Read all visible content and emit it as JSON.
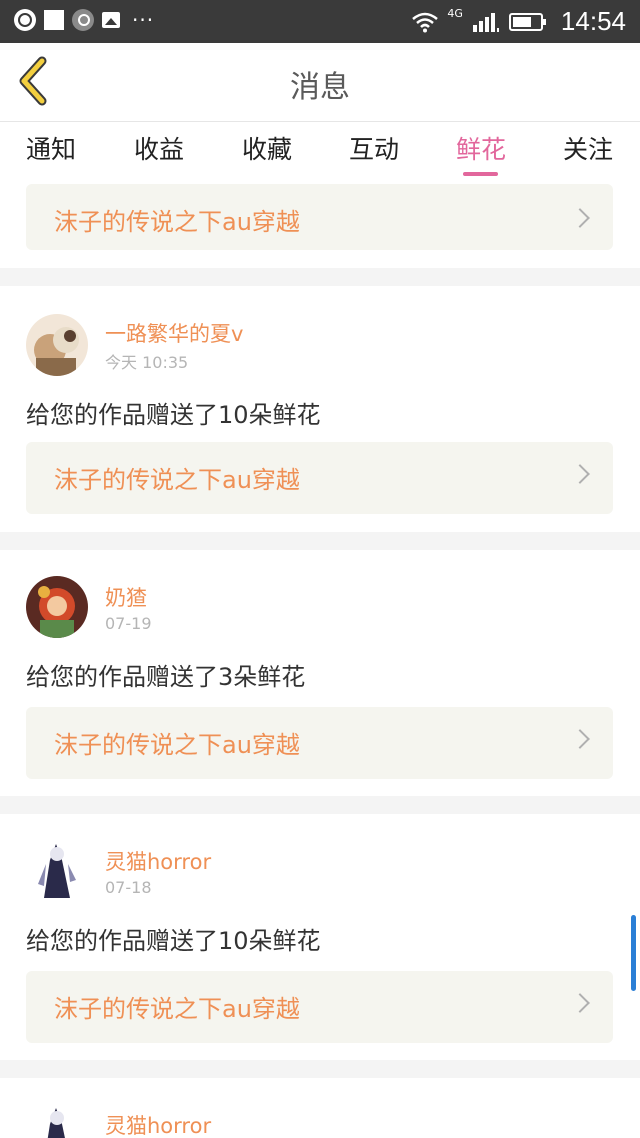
{
  "status_bar": {
    "time": "14:54",
    "network": "4G",
    "left_icons": [
      "globe-icon",
      "square-icon",
      "search-icon",
      "image-icon",
      "more-dots-icon"
    ],
    "right_icons": [
      "wifi-icon",
      "signal-icon",
      "battery-icon"
    ]
  },
  "header": {
    "title": "消息",
    "back_icon": "chevron-left-icon"
  },
  "tabs": [
    {
      "label": "通知",
      "active": false
    },
    {
      "label": "收益",
      "active": false
    },
    {
      "label": "收藏",
      "active": false
    },
    {
      "label": "互动",
      "active": false
    },
    {
      "label": "鲜花",
      "active": true
    },
    {
      "label": "关注",
      "active": false
    }
  ],
  "colors": {
    "accent_pink": "#e2679c",
    "orange_text": "#ef9055",
    "link_bg": "#f5f5ef"
  },
  "top_partial_card": {
    "work_title": "沫子的传说之下au穿越"
  },
  "messages": [
    {
      "username": "一路繁华的夏v",
      "time": "今天 10:35",
      "text": "给您的作品赠送了10朵鲜花",
      "work_title": "沫子的传说之下au穿越"
    },
    {
      "username": "奶猹",
      "time": "07-19",
      "text": "给您的作品赠送了3朵鲜花",
      "work_title": "沫子的传说之下au穿越"
    },
    {
      "username": "灵猫horror",
      "time": "07-18",
      "text": "给您的作品赠送了10朵鲜花",
      "work_title": "沫子的传说之下au穿越"
    },
    {
      "username": "灵猫horror"
    }
  ]
}
